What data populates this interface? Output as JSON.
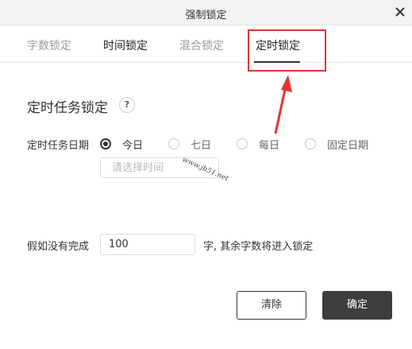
{
  "window": {
    "title": "强制锁定"
  },
  "tabs": [
    {
      "label": "字数锁定"
    },
    {
      "label": "时间锁定"
    },
    {
      "label": "混合锁定"
    },
    {
      "label": "定时锁定",
      "active": true
    }
  ],
  "section": {
    "title": "定时任务锁定",
    "help": "?"
  },
  "schedule": {
    "label": "定时任务日期",
    "options": [
      {
        "label": "今日",
        "checked": true
      },
      {
        "label": "七日",
        "checked": false
      },
      {
        "label": "每日",
        "checked": false
      },
      {
        "label": "固定日期",
        "checked": false
      }
    ],
    "time_placeholder": "请选择时间"
  },
  "watermark": "www.jb51.net",
  "fallback": {
    "label": "假如没有完成",
    "value": "100",
    "suffix": "字, 其余字数将进入锁定"
  },
  "buttons": {
    "clear": "清除",
    "ok": "确定"
  },
  "colors": {
    "annotation_red": "#e53333",
    "primary_button": "#3d3d3d"
  }
}
